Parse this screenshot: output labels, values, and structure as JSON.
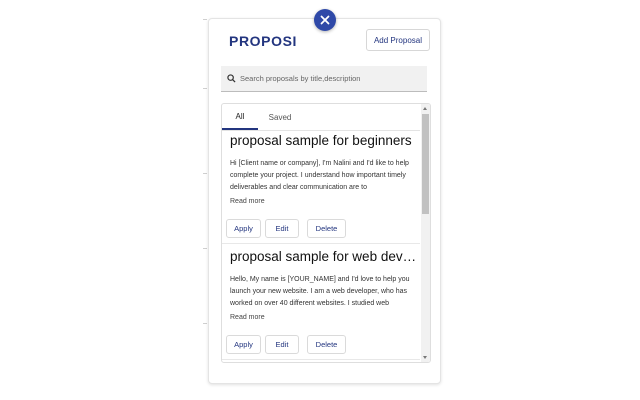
{
  "app": {
    "logo": "PROPOSI",
    "add_button_label": "Add Proposal"
  },
  "close_icon": "close-icon",
  "search": {
    "placeholder": "Search proposals by title,description",
    "value": "",
    "icon": "search-icon"
  },
  "tabs": [
    {
      "label": "All",
      "active": true
    },
    {
      "label": "Saved",
      "active": false
    }
  ],
  "proposals": [
    {
      "title": "proposal sample for beginners",
      "preview": "Hi [Client name or company], I'm Nalini and I'd like to help complete your project. I understand how important timely deliverables and clear communication are to",
      "read_more": "Read more",
      "actions": [
        "Apply",
        "Edit",
        "Delete"
      ]
    },
    {
      "title": "proposal sample for web devel...",
      "preview": "Hello, My name is [YOUR_NAME] and I'd love to help you launch your new website. I am a web developer, who has worked on over 40 different websites. I studied web",
      "read_more": "Read more",
      "actions": [
        "Apply",
        "Edit",
        "Delete"
      ]
    }
  ],
  "colors": {
    "accent": "#23357f",
    "close_button": "#2f49a8"
  }
}
